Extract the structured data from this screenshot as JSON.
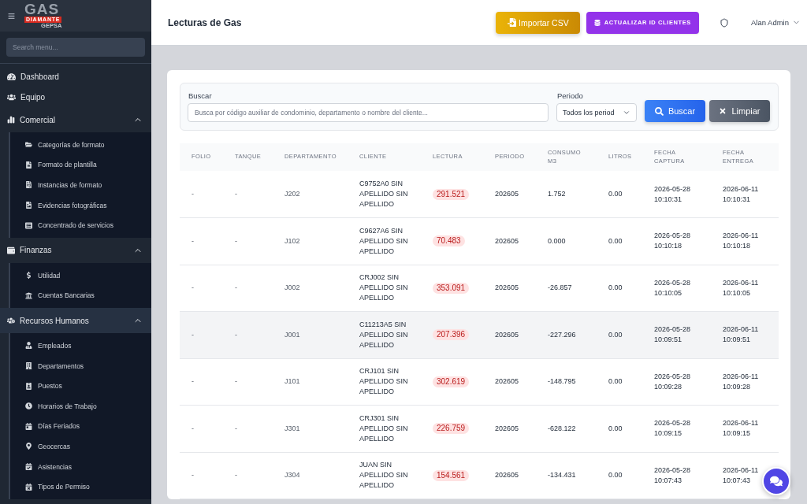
{
  "sidebar": {
    "logo": {
      "wordmark": "GAS",
      "band": "DIAMANTE",
      "tagline": "GEPSA"
    },
    "search": {
      "placeholder": "Search menu..."
    },
    "items": [
      {
        "kind": "link",
        "label": "Dashboard",
        "selected": false
      },
      {
        "kind": "link",
        "label": "Equipo",
        "selected": false
      },
      {
        "kind": "section",
        "label": "Comercial",
        "selected": false,
        "expanded": true,
        "children": [
          {
            "label": "Categorías de formato",
            "selected": false
          },
          {
            "label": "Formato de plantilla",
            "selected": false
          },
          {
            "label": "Instancias de formato",
            "selected": false
          },
          {
            "label": "Evidencias fotográficas",
            "selected": false
          },
          {
            "label": "Concentrado de servicios",
            "selected": false
          }
        ]
      },
      {
        "kind": "section",
        "label": "Finanzas",
        "selected": false,
        "expanded": true,
        "children": [
          {
            "label": "Utilidad",
            "selected": false
          },
          {
            "label": "Cuentas Bancarias",
            "selected": false
          }
        ]
      },
      {
        "kind": "section",
        "label": "Recursos Humanos",
        "selected": true,
        "expanded": true,
        "children": [
          {
            "label": "Empleados",
            "selected": false
          },
          {
            "label": "Departamentos",
            "selected": false
          },
          {
            "label": "Puestos",
            "selected": false
          },
          {
            "label": "Horarios de Trabajo",
            "selected": false
          },
          {
            "label": "Días Feriados",
            "selected": false
          },
          {
            "label": "Geocercas",
            "selected": false
          },
          {
            "label": "Asistencias",
            "selected": false
          },
          {
            "label": "Tipos de Permiso",
            "selected": false
          }
        ]
      }
    ]
  },
  "header": {
    "title": "Lecturas de Gas",
    "actions": [
      {
        "kind": "import",
        "label": "Importar CSV"
      },
      {
        "kind": "update",
        "label": "ACTUALIZAR ID CLIENTES"
      }
    ],
    "user": {
      "name": "Alan Admin"
    }
  },
  "filters": {
    "search": {
      "label": "Buscar",
      "placeholder": "Busca por código auxiliar de condominio, departamento o nombre del cliente..."
    },
    "period": {
      "label": "Periodo",
      "value": "Todos los period"
    },
    "buttons": [
      {
        "kind": "search",
        "label": "Buscar"
      },
      {
        "kind": "clear",
        "label": "Limpiar"
      }
    ]
  },
  "table": {
    "columns": [
      {
        "label": "FOLIO",
        "kind": "muted"
      },
      {
        "label": "TANQUE",
        "kind": "muted"
      },
      {
        "label": "DEPARTAMENTO",
        "kind": "muted"
      },
      {
        "label": "CLIENTE",
        "kind": "text"
      },
      {
        "label": "LECTURA",
        "kind": "badge"
      },
      {
        "label": "PERIODO",
        "kind": "text"
      },
      {
        "label": "CONSUMO M3",
        "kind": "text"
      },
      {
        "label": "LITROS",
        "kind": "text"
      },
      {
        "label": "FECHA CAPTURA",
        "kind": "text"
      },
      {
        "label": "FECHA ENTREGA",
        "kind": "text"
      }
    ],
    "rows": [
      {
        "hovered": false,
        "cells": [
          "-",
          "-",
          "J202",
          "C9752A0 SIN APELLIDO SIN APELLIDO",
          "291.521",
          "202605",
          "1.752",
          "0.00",
          "2026-05-28 10:10:31",
          "2026-06-11 10:10:31"
        ]
      },
      {
        "hovered": false,
        "cells": [
          "-",
          "-",
          "J102",
          "C9627A6 SIN APELLIDO SIN APELLIDO",
          "70.483",
          "202605",
          "0.000",
          "0.00",
          "2026-05-28 10:10:18",
          "2026-06-11 10:10:18"
        ]
      },
      {
        "hovered": false,
        "cells": [
          "-",
          "-",
          "J002",
          "CRJ002 SIN APELLIDO SIN APELLIDO",
          "353.091",
          "202605",
          "-26.857",
          "0.00",
          "2026-05-28 10:10:05",
          "2026-06-11 10:10:05"
        ]
      },
      {
        "hovered": true,
        "cells": [
          "-",
          "-",
          "J001",
          "C11213A5 SIN APELLIDO SIN APELLIDO",
          "207.396",
          "202605",
          "-227.296",
          "0.00",
          "2026-05-28 10:09:51",
          "2026-06-11 10:09:51"
        ]
      },
      {
        "hovered": false,
        "cells": [
          "-",
          "-",
          "J101",
          "CRJ101 SIN APELLIDO SIN APELLIDO",
          "302.619",
          "202605",
          "-148.795",
          "0.00",
          "2026-05-28 10:09:28",
          "2026-06-11 10:09:28"
        ]
      },
      {
        "hovered": false,
        "cells": [
          "-",
          "-",
          "J301",
          "CRJ301 SIN APELLIDO SIN APELLIDO",
          "226.759",
          "202605",
          "-628.122",
          "0.00",
          "2026-05-28 10:09:15",
          "2026-06-11 10:09:15"
        ]
      },
      {
        "hovered": false,
        "cells": [
          "-",
          "-",
          "J304",
          "JUAN SIN APELLIDO SIN APELLIDO",
          "154.561",
          "202605",
          "-134.431",
          "0.00",
          "2026-05-28 10:07:43",
          "2026-06-11 10:07:43"
        ]
      }
    ]
  }
}
